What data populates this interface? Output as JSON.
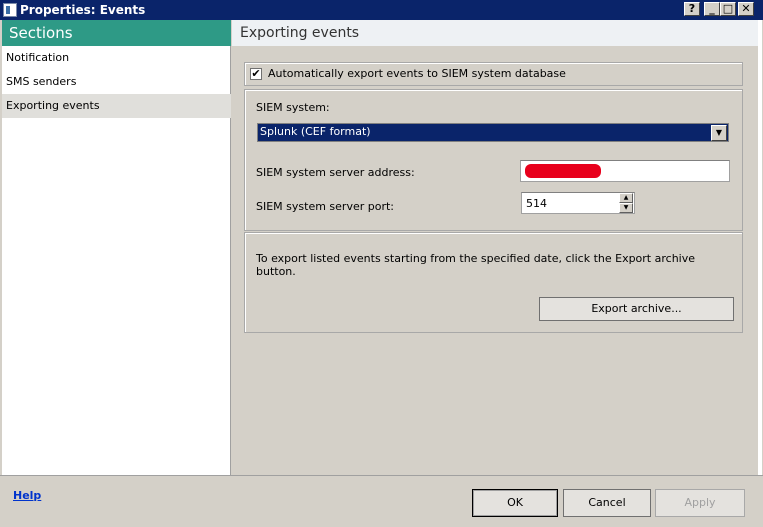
{
  "window": {
    "title": "Properties: Events"
  },
  "titlebar_buttons": {
    "help": "?",
    "minimize": "_",
    "maximize": "□",
    "close": "✕"
  },
  "sections": {
    "header": "Sections",
    "items": [
      {
        "label": "Notification"
      },
      {
        "label": "SMS senders"
      },
      {
        "label": "Exporting events",
        "active": true
      }
    ]
  },
  "main": {
    "header": "Exporting events",
    "auto_export": {
      "label": "Automatically export events to SIEM system database",
      "checked": true,
      "check_glyph": "✔"
    },
    "siem_system": {
      "label": "SIEM system:",
      "value": "Splunk (CEF format)"
    },
    "server_address": {
      "label": "SIEM system server address:",
      "value": ""
    },
    "server_port": {
      "label": "SIEM system server port:",
      "value": "514"
    },
    "archive": {
      "description": "To export listed events starting from the specified date, click the Export archive button.",
      "button_label": "Export archive..."
    }
  },
  "footer": {
    "help_link": "Help",
    "ok_label": "OK",
    "cancel_label": "Cancel",
    "apply_label": "Apply"
  },
  "glyphs": {
    "dropdown": "▼",
    "spin_up": "▲",
    "spin_down": "▼"
  },
  "colors": {
    "titlebar": "#0a246a",
    "sections_header": "#2e9a86",
    "selection": "#0a246a"
  }
}
